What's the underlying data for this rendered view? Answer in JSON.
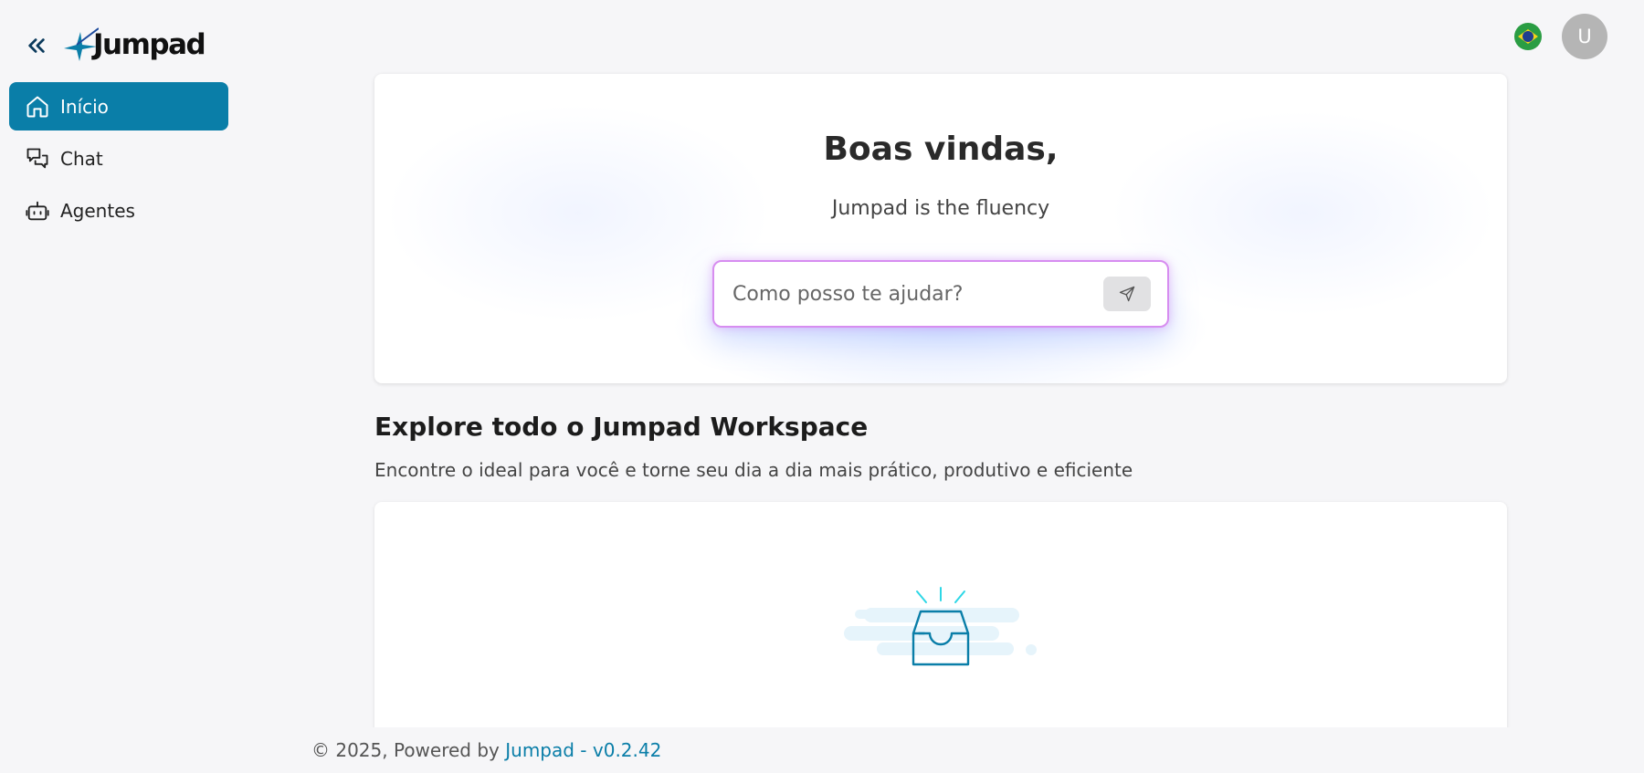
{
  "brand": {
    "name": "Jumpad",
    "accent": "#0a7ea8"
  },
  "sidebar": {
    "collapse_icon": "double-chevron-left-icon",
    "items": [
      {
        "label": "Início",
        "icon": "home-icon",
        "active": true
      },
      {
        "label": "Chat",
        "icon": "chat-bubbles-icon",
        "active": false
      },
      {
        "label": "Agentes",
        "icon": "robot-icon",
        "active": false
      }
    ]
  },
  "header": {
    "language_flag": "brazil-flag-icon",
    "avatar_initial": "U"
  },
  "hero": {
    "title": "Boas vindas,",
    "subtitle": "Jumpad is the fluency",
    "prompt_placeholder": "Como posso te ajudar?",
    "send_icon": "send-icon"
  },
  "workspace": {
    "title": "Explore todo o Jumpad Workspace",
    "subtitle": "Encontre o ideal para você e torne seu dia a dia mais prático, produtivo e eficiente",
    "empty_state_icon": "empty-inbox-icon"
  },
  "footer": {
    "prefix": "© 2025, Powered by",
    "link": "Jumpad - v0.2.42"
  }
}
